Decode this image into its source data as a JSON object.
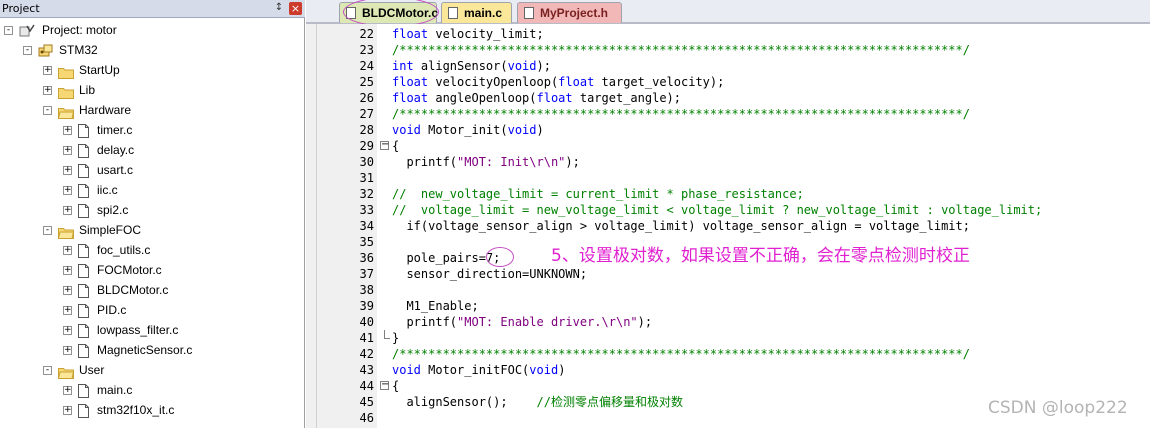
{
  "project_panel": {
    "title": "Project",
    "pin_glyph": "↕",
    "close_glyph": "×",
    "tree": {
      "root": "Project: motor",
      "target": "STM32",
      "groups": [
        {
          "name": "StartUp",
          "expanded": false,
          "files": []
        },
        {
          "name": "Lib",
          "expanded": false,
          "files": []
        },
        {
          "name": "Hardware",
          "expanded": true,
          "files": [
            "timer.c",
            "delay.c",
            "usart.c",
            "iic.c",
            "spi2.c"
          ]
        },
        {
          "name": "SimpleFOC",
          "expanded": true,
          "files": [
            "foc_utils.c",
            "FOCMotor.c",
            "BLDCMotor.c",
            "PID.c",
            "lowpass_filter.c",
            "MagneticSensor.c"
          ]
        },
        {
          "name": "User",
          "expanded": true,
          "files": [
            "main.c",
            "stm32f10x_it.c"
          ]
        }
      ]
    }
  },
  "tabs": [
    {
      "label": "BLDCMotor.c",
      "active": true
    },
    {
      "label": "main.c",
      "active": false
    },
    {
      "label": "MyProject.h",
      "active": false
    }
  ],
  "editor": {
    "lines": [
      {
        "n": "22",
        "text": "float velocity_limit;"
      },
      {
        "n": "23",
        "text": "/******************************************************************************/"
      },
      {
        "n": "24",
        "text": "int alignSensor(void);"
      },
      {
        "n": "25",
        "text": "float velocityOpenloop(float target_velocity);"
      },
      {
        "n": "26",
        "text": "float angleOpenloop(float target_angle);"
      },
      {
        "n": "27",
        "text": "/******************************************************************************/"
      },
      {
        "n": "28",
        "text": "void Motor_init(void)"
      },
      {
        "n": "29",
        "text": "{"
      },
      {
        "n": "30",
        "text": "  printf(\"MOT: Init\\r\\n\");"
      },
      {
        "n": "31",
        "text": ""
      },
      {
        "n": "32",
        "text": "//  new_voltage_limit = current_limit * phase_resistance;"
      },
      {
        "n": "33",
        "text": "//  voltage_limit = new_voltage_limit < voltage_limit ? new_voltage_limit : voltage_limit;"
      },
      {
        "n": "34",
        "text": "  if(voltage_sensor_align > voltage_limit) voltage_sensor_align = voltage_limit;"
      },
      {
        "n": "35",
        "text": ""
      },
      {
        "n": "36",
        "text": "  pole_pairs=7;"
      },
      {
        "n": "37",
        "text": "  sensor_direction=UNKNOWN;"
      },
      {
        "n": "38",
        "text": ""
      },
      {
        "n": "39",
        "text": "  M1_Enable;"
      },
      {
        "n": "40",
        "text": "  printf(\"MOT: Enable driver.\\r\\n\");"
      },
      {
        "n": "41",
        "text": "}"
      },
      {
        "n": "42",
        "text": "/******************************************************************************/"
      },
      {
        "n": "43",
        "text": "void Motor_initFOC(void)"
      },
      {
        "n": "44",
        "text": "{"
      },
      {
        "n": "45",
        "text": "  alignSensor();    //检测零点偏移量和极对数"
      },
      {
        "n": "46",
        "text": ""
      }
    ]
  },
  "annotation": "5、设置极对数，如果设置不正确，会在零点检测时校正",
  "watermark": "CSDN @loop222",
  "colors": {
    "keyword": "#0000ff",
    "comment": "#008000",
    "string": "#800080",
    "annotation": "#e020d0",
    "active_tab": "#dde8b5"
  }
}
